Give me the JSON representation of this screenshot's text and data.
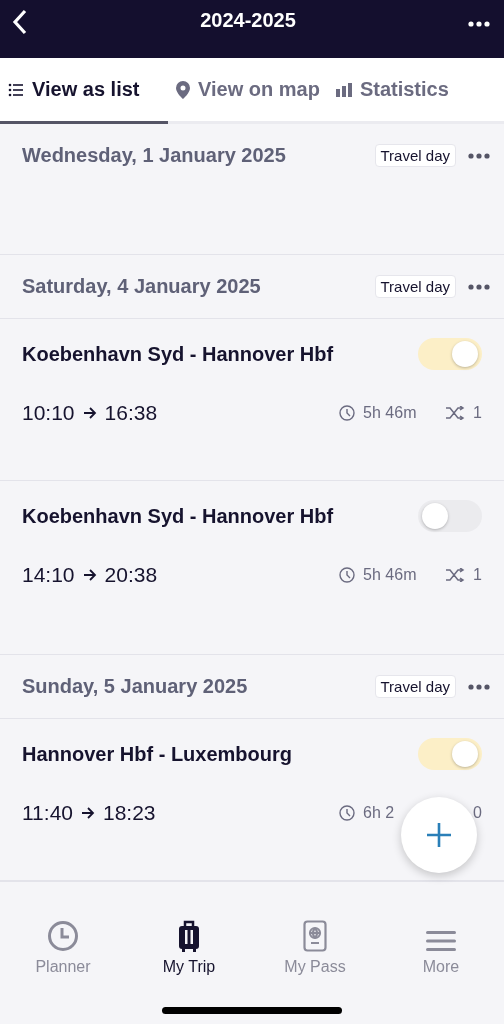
{
  "header": {
    "title": "2024-2025"
  },
  "tabs": [
    {
      "label": "View as list",
      "selected": true
    },
    {
      "label": "View on map",
      "selected": false
    },
    {
      "label": "Statistics",
      "selected": false
    }
  ],
  "days": [
    {
      "date": "Wednesday, 1 January 2025",
      "tag": "Travel day"
    },
    {
      "date": "Saturday, 4 January 2025",
      "tag": "Travel day",
      "journeys": [
        {
          "route": "Koebenhavn Syd - Hannover Hbf",
          "departure": "10:10",
          "arrival": "16:38",
          "duration": "5h 46m",
          "changes": "1",
          "on": true,
          "changes_icon": true
        },
        {
          "route": "Koebenhavn Syd - Hannover Hbf",
          "departure": "14:10",
          "arrival": "20:38",
          "duration": "5h 46m",
          "changes": "1",
          "on": false,
          "changes_icon": true
        }
      ]
    },
    {
      "date": "Sunday, 5 January 2025",
      "tag": "Travel day",
      "journeys": [
        {
          "route": "Hannover Hbf - Luxembourg",
          "departure": "11:40",
          "arrival": "18:23",
          "duration": "6h 2",
          "changes": "0",
          "on": true,
          "changes_icon": false
        }
      ]
    }
  ],
  "nav": [
    {
      "label": "Planner",
      "selected": false
    },
    {
      "label": "My Trip",
      "selected": true
    },
    {
      "label": "My Pass",
      "selected": false
    },
    {
      "label": "More",
      "selected": false
    }
  ]
}
